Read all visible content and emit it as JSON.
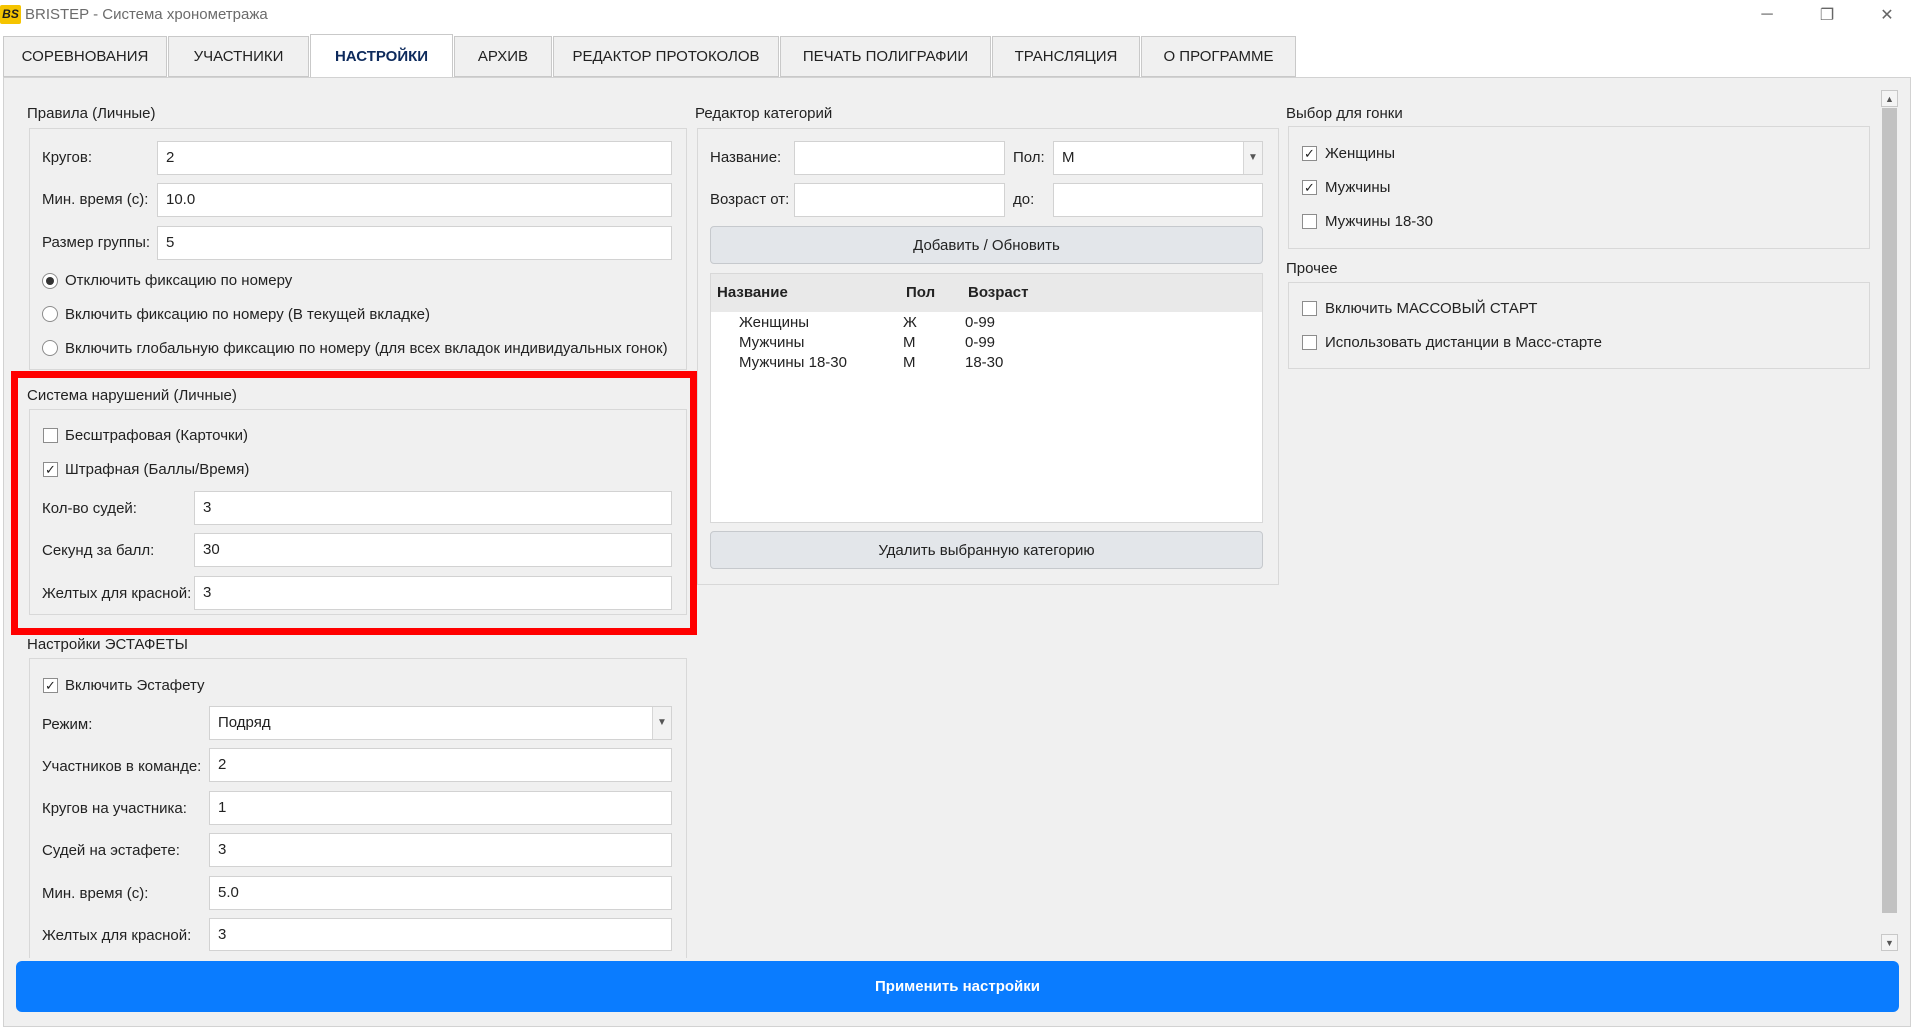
{
  "window": {
    "logo": "BS",
    "title": "BRISTEP - Система хронометража",
    "minimize": "─",
    "restore": "❐",
    "close": "✕"
  },
  "tabs": [
    {
      "label": "СОРЕВНОВАНИЯ",
      "active": false
    },
    {
      "label": "УЧАСТНИКИ",
      "active": false
    },
    {
      "label": "НАСТРОЙКИ",
      "active": true
    },
    {
      "label": "АРХИВ",
      "active": false
    },
    {
      "label": "РЕДАКТОР ПРОТОКОЛОВ",
      "active": false
    },
    {
      "label": "ПЕЧАТЬ ПОЛИГРАФИИ",
      "active": false
    },
    {
      "label": "ТРАНСЛЯЦИЯ",
      "active": false
    },
    {
      "label": "О ПРОГРАММЕ",
      "active": false
    }
  ],
  "rules": {
    "title": "Правила (Личные)",
    "laps_label": "Кругов:",
    "laps_value": "2",
    "min_time_label": "Мин. время (с):",
    "min_time_value": "10.0",
    "group_size_label": "Размер группы:",
    "group_size_value": "5",
    "radios": [
      {
        "label": "Отключить фиксацию по номеру",
        "selected": true
      },
      {
        "label": "Включить фиксацию по номеру (В текущей вкладке)",
        "selected": false
      },
      {
        "label": "Включить глобальную фиксацию по номеру (для всех вкладок индивидуальных гонок)",
        "selected": false
      }
    ]
  },
  "violations": {
    "title": "Система нарушений (Личные)",
    "no_penalty_label": "Бесштрафовая (Карточки)",
    "no_penalty_checked": false,
    "penalty_label": "Штрафная (Баллы/Время)",
    "penalty_checked": true,
    "judges_label": "Кол-во судей:",
    "judges_value": "3",
    "sec_per_point_label": "Секунд за балл:",
    "sec_per_point_value": "30",
    "yellow_for_red_label": "Желтых для красной:",
    "yellow_for_red_value": "3"
  },
  "relay": {
    "title": "Настройки ЭСТАФЕТЫ",
    "enable_label": "Включить Эстафету",
    "enable_checked": true,
    "mode_label": "Режим:",
    "mode_value": "Подряд",
    "team_size_label": "Участников в команде:",
    "team_size_value": "2",
    "laps_per_label": "Кругов на участника:",
    "laps_per_value": "1",
    "judges_label": "Судей на эстафете:",
    "judges_value": "3",
    "min_time_label": "Мин. время (с):",
    "min_time_value": "5.0",
    "yellow_label": "Желтых для красной:",
    "yellow_value": "3"
  },
  "categories": {
    "title": "Редактор категорий",
    "name_label": "Название:",
    "name_value": "",
    "gender_label": "Пол:",
    "gender_value": "М",
    "age_from_label": "Возраст от:",
    "age_from_value": "",
    "age_to_label": "до:",
    "age_to_value": "",
    "add_button": "Добавить / Обновить",
    "columns": [
      "Название",
      "Пол",
      "Возраст"
    ],
    "rows": [
      [
        "Женщины",
        "Ж",
        "0-99"
      ],
      [
        "Мужчины",
        "М",
        "0-99"
      ],
      [
        "Мужчины 18-30",
        "М",
        "18-30"
      ]
    ],
    "delete_button": "Удалить выбранную категорию"
  },
  "race_select": {
    "title": "Выбор для гонки",
    "items": [
      {
        "label": "Женщины",
        "checked": true
      },
      {
        "label": "Мужчины",
        "checked": true
      },
      {
        "label": "Мужчины 18-30",
        "checked": false
      }
    ]
  },
  "other": {
    "title": "Прочее",
    "items": [
      {
        "label": "Включить МАССОВЫЙ СТАРТ",
        "checked": false
      },
      {
        "label": "Использовать дистанции в Масс-старте",
        "checked": false
      }
    ]
  },
  "apply_button": "Применить настройки",
  "icons": {
    "check": "✓",
    "dropdown": "▼",
    "scroll_up": "▲",
    "scroll_down": "▼"
  },
  "colors": {
    "accent": "#0a7cff",
    "highlight": "#ff0000",
    "active_tab_text": "#0d2a5c"
  }
}
